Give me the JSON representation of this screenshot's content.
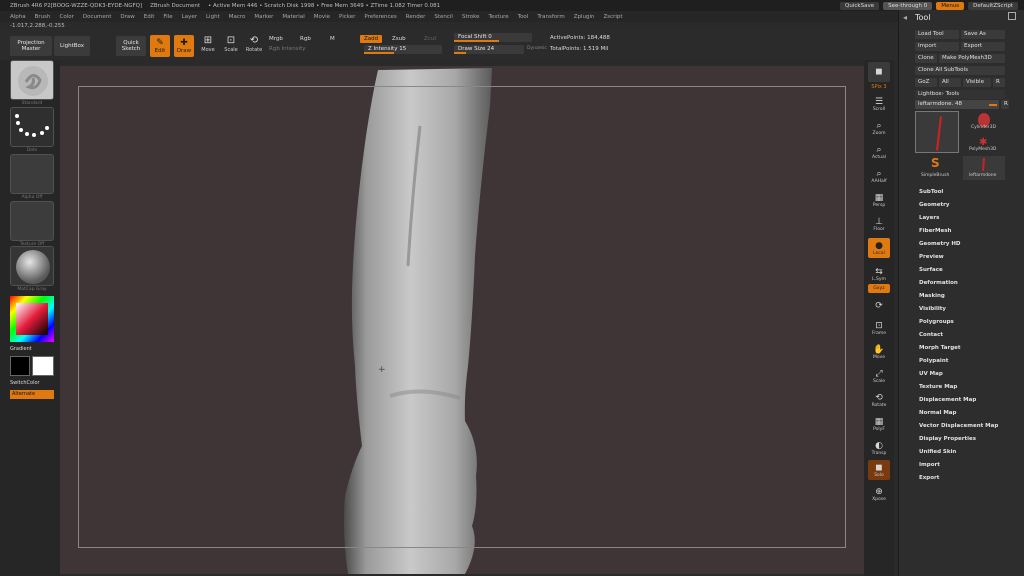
{
  "titlebar": {
    "app": "ZBrush 4R6 P2[BOOG-WZZE-QDK3-EYDE-NGFQ]",
    "doc": "ZBrush Document",
    "memory": "• Active Mem 446 • Scratch Disk 1998 • Free Mem 3649 • ZTime 1.082 Timer 0.081",
    "quicksave": "QuickSave",
    "see_through": "See-through 0",
    "menus": "Menus",
    "default_script": "DefaultZScript"
  },
  "menubar": [
    "Alpha",
    "Brush",
    "Color",
    "Document",
    "Draw",
    "Edit",
    "File",
    "Layer",
    "Light",
    "Macro",
    "Marker",
    "Material",
    "Movie",
    "Picker",
    "Preferences",
    "Render",
    "Stencil",
    "Stroke",
    "Texture",
    "Tool",
    "Transform",
    "Zplugin",
    "Zscript"
  ],
  "coordinates": "-1.017,2.288,-0.255",
  "toolbar": {
    "projection_master": "Projection Master",
    "lightbox": "LightBox",
    "quick_sketch": "Quick Sketch",
    "edit": "Edit",
    "draw": "Draw",
    "move": "Move",
    "scale": "Scale",
    "rotate": "Rotate",
    "mrgb": "Mrgb",
    "rgb": "Rgb",
    "m": "M",
    "rgb_intensity": "Rgb Intensity",
    "zadd": "Zadd",
    "zsub": "Zsub",
    "zcut": "Zcut",
    "z_intensity": "Z Intensity 15",
    "focal_shift": "Focal Shift 0",
    "draw_size": "Draw Size 24",
    "dynamic": "Dynamic",
    "active_points": "ActivePoints: 184,488",
    "total_points": "TotalPoints: 1.519 Mil"
  },
  "left_panel": {
    "brush": "Standard",
    "stroke": "Dots",
    "alpha": "Alpha Off",
    "texture": "Texture Off",
    "material": "MatCap Gray",
    "gradient": "Gradient",
    "switch_color": "SwitchColor",
    "alternate": "Alternate"
  },
  "right_shelf": [
    {
      "name": "bpr",
      "label": "BPR"
    },
    {
      "name": "spix",
      "label": "SPix 3"
    },
    {
      "name": "scroll",
      "label": "Scroll"
    },
    {
      "name": "zoom",
      "label": "Zoom"
    },
    {
      "name": "actual",
      "label": "Actual"
    },
    {
      "name": "aahalf",
      "label": "AAHalf"
    },
    {
      "name": "persp",
      "label": "Persp"
    },
    {
      "name": "floor",
      "label": "Floor"
    },
    {
      "name": "local",
      "label": "Local"
    },
    {
      "name": "xyz",
      "label": "L.Sym"
    },
    {
      "name": "xpose",
      "label": "Gxyz"
    },
    {
      "name": "frame",
      "label": "Frame"
    },
    {
      "name": "move",
      "label": "Move"
    },
    {
      "name": "scale",
      "label": "Scale"
    },
    {
      "name": "rotate",
      "label": "Rotate"
    },
    {
      "name": "polyf",
      "label": "PolyF"
    },
    {
      "name": "transp",
      "label": "Transp"
    },
    {
      "name": "solo",
      "label": "Solo"
    },
    {
      "name": "xpose2",
      "label": "Xpose"
    }
  ],
  "tool_panel": {
    "title": "Tool",
    "load_tool": "Load Tool",
    "save_as": "Save As",
    "import": "Import",
    "export": "Export",
    "clone": "Clone",
    "make_polymesh": "Make PolyMesh3D",
    "clone_all": "Clone All SubTools",
    "goz": "GoZ",
    "all": "All",
    "visible": "Visible",
    "r": "R",
    "lightbox_tools": "Lightbox› Tools",
    "current_tool": "leftarmdone. 48",
    "thumbs": [
      "leftarmdone",
      "Cylinder3D",
      "PolyMesh3D",
      "SimpleBrush",
      "leftarmdone"
    ],
    "sections": [
      "SubTool",
      "Geometry",
      "Layers",
      "FiberMesh",
      "Geometry HD",
      "Preview",
      "Surface",
      "Deformation",
      "Masking",
      "Visibility",
      "Polygroups",
      "Contact",
      "Morph Target",
      "Polypaint",
      "UV Map",
      "Texture Map",
      "Displacement Map",
      "Normal Map",
      "Vector Displacement Map",
      "Display Properties",
      "Unified Skin",
      "Import",
      "Export"
    ]
  },
  "colors": {
    "accent": "#e07a10",
    "canvas": "#3f3536",
    "panel": "#2d2d2d"
  }
}
